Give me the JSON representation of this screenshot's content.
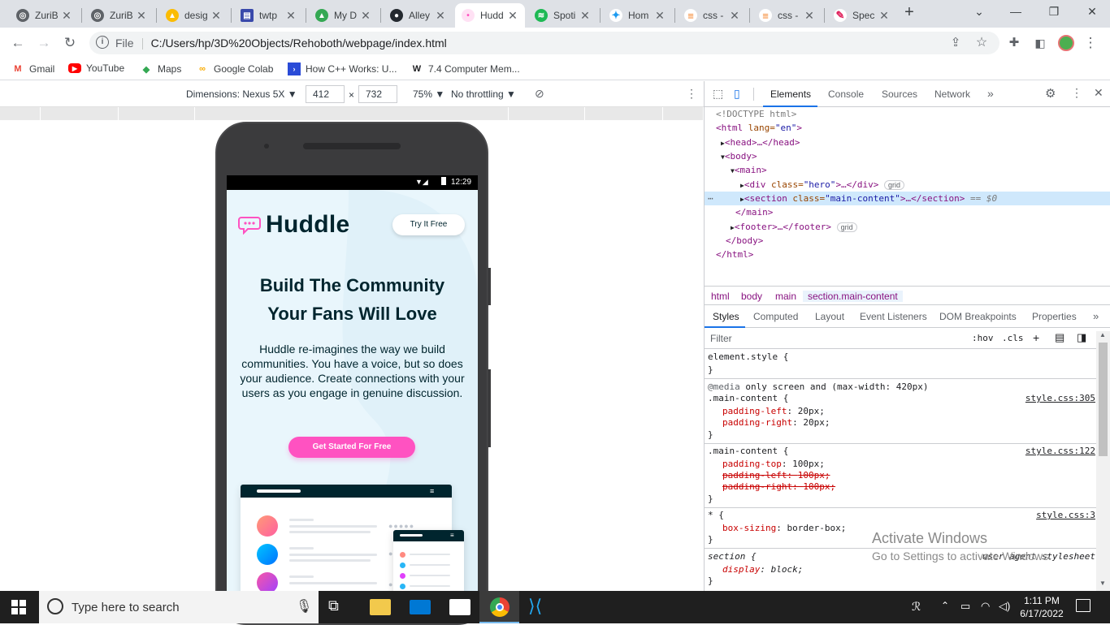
{
  "browser": {
    "tabs": [
      {
        "title": "ZuriB",
        "color": "#5f6368",
        "icon": "globe-icon"
      },
      {
        "title": "ZuriB",
        "color": "#5f6368",
        "icon": "globe-icon"
      },
      {
        "title": "desig",
        "color": "#fbbc04",
        "icon": "google-drive-icon"
      },
      {
        "title": "twtp",
        "color": "#3949ab",
        "icon": "pdf-icon"
      },
      {
        "title": "My D",
        "color": "#34a853",
        "icon": "google-drive-icon"
      },
      {
        "title": "Alley",
        "color": "#24292f",
        "icon": "github-icon"
      },
      {
        "title": "Hudd",
        "color": "#ff52c1",
        "icon": "huddle-icon"
      },
      {
        "title": "Spoti",
        "color": "#1db954",
        "icon": "spotify-icon"
      },
      {
        "title": "Hom",
        "color": "#1d9bf0",
        "icon": "twitter-icon"
      },
      {
        "title": "css -",
        "color": "#f48024",
        "icon": "stackoverflow-icon"
      },
      {
        "title": "css -",
        "color": "#f48024",
        "icon": "stackoverflow-icon"
      },
      {
        "title": "Spec",
        "color": "#e0245e",
        "icon": "spec-icon"
      }
    ],
    "new_tab": "+",
    "url_prefix": "File",
    "url": "C:/Users/hp/3D%20Objects/Rehoboth/webpage/index.html",
    "bookmarks": [
      {
        "label": "Gmail",
        "icon": "gmail-icon"
      },
      {
        "label": "YouTube",
        "icon": "youtube-icon"
      },
      {
        "label": "Maps",
        "icon": "maps-icon"
      },
      {
        "label": "Google Colab",
        "icon": "colab-icon"
      },
      {
        "label": "How C++ Works: U...",
        "icon": "bookmark-icon"
      },
      {
        "label": "7.4 Computer Mem...",
        "icon": "w-icon"
      }
    ]
  },
  "device_toolbar": {
    "dimensions_label": "Dimensions: Nexus 5X",
    "width": "412",
    "height": "732",
    "times": "×",
    "zoom": "75%",
    "throttling": "No throttling"
  },
  "phone": {
    "status_time": "12:29",
    "logo_text": "Huddle",
    "try_button": "Try It Free",
    "hero_title": "Build The Community Your Fans Will Love",
    "hero_text": "Huddle re-imagines the way we build communities. You have a voice, but so does your audience. Create connections with your users as you engage in genuine discussion.",
    "cta_button": "Get Started For Free"
  },
  "devtools": {
    "tabs": [
      "Elements",
      "Console",
      "Sources",
      "Network"
    ],
    "more": "»",
    "dom": {
      "doctype": "<!DOCTYPE html>",
      "html_open_tag": "html",
      "html_attr": " lang=",
      "html_attr_val": "\"en\"",
      "head": "<head>…</head>",
      "body_open": "<body>",
      "main_open": "<main>",
      "hero_tag": "div",
      "hero_attr": " class=",
      "hero_val": "\"hero\"",
      "hero_close": ">…</div>",
      "grid_badge": "grid",
      "section_tag": "section",
      "section_attr": " class=",
      "section_val": "\"main-content\"",
      "section_close": ">…</section>",
      "section_ref": "== $0",
      "main_close": "</main>",
      "footer": "<footer>…</footer>",
      "body_close": "</body>",
      "html_close": "</html>"
    },
    "breadcrumbs": [
      "html",
      "body",
      "main",
      "section.main-content"
    ],
    "style_tabs": [
      "Styles",
      "Computed",
      "Layout",
      "Event Listeners",
      "DOM Breakpoints",
      "Properties"
    ],
    "filter_placeholder": "Filter",
    "hov": ":hov",
    "cls": ".cls",
    "rules": {
      "element_style": "element.style {",
      "close": "}",
      "media_at": "@media",
      "media_query": " only screen and (max-width: 420px)",
      "r1_selector": ".main-content {",
      "r1_source": "style.css:305",
      "r1_props": [
        {
          "name": "padding-left",
          "value": "20px;"
        },
        {
          "name": "padding-right",
          "value": "20px;"
        }
      ],
      "r2_selector": ".main-content {",
      "r2_source": "style.css:122",
      "r2_props": [
        {
          "name": "padding-top",
          "value": "100px;"
        },
        {
          "name": "padding-left",
          "value": "100px;"
        },
        {
          "name": "padding-right",
          "value": "100px;"
        }
      ],
      "r3_selector": "* {",
      "r3_source": "style.css:3",
      "r3_prop": {
        "name": "box-sizing",
        "value": "border-box;"
      },
      "r4_selector": "section {",
      "r4_source": "user agent stylesheet",
      "r4_prop": {
        "name": "display",
        "value": "block;"
      }
    }
  },
  "watermark": {
    "line1": "Activate Windows",
    "line2": "Go to Settings to activate Windows."
  },
  "taskbar": {
    "search_placeholder": "Type here to search",
    "time": "1:11 PM",
    "date": "6/17/2022"
  },
  "colors": {
    "accent": "#1a73e8",
    "brand_pink": "#ff52c1",
    "brand_dark": "#00252e"
  }
}
